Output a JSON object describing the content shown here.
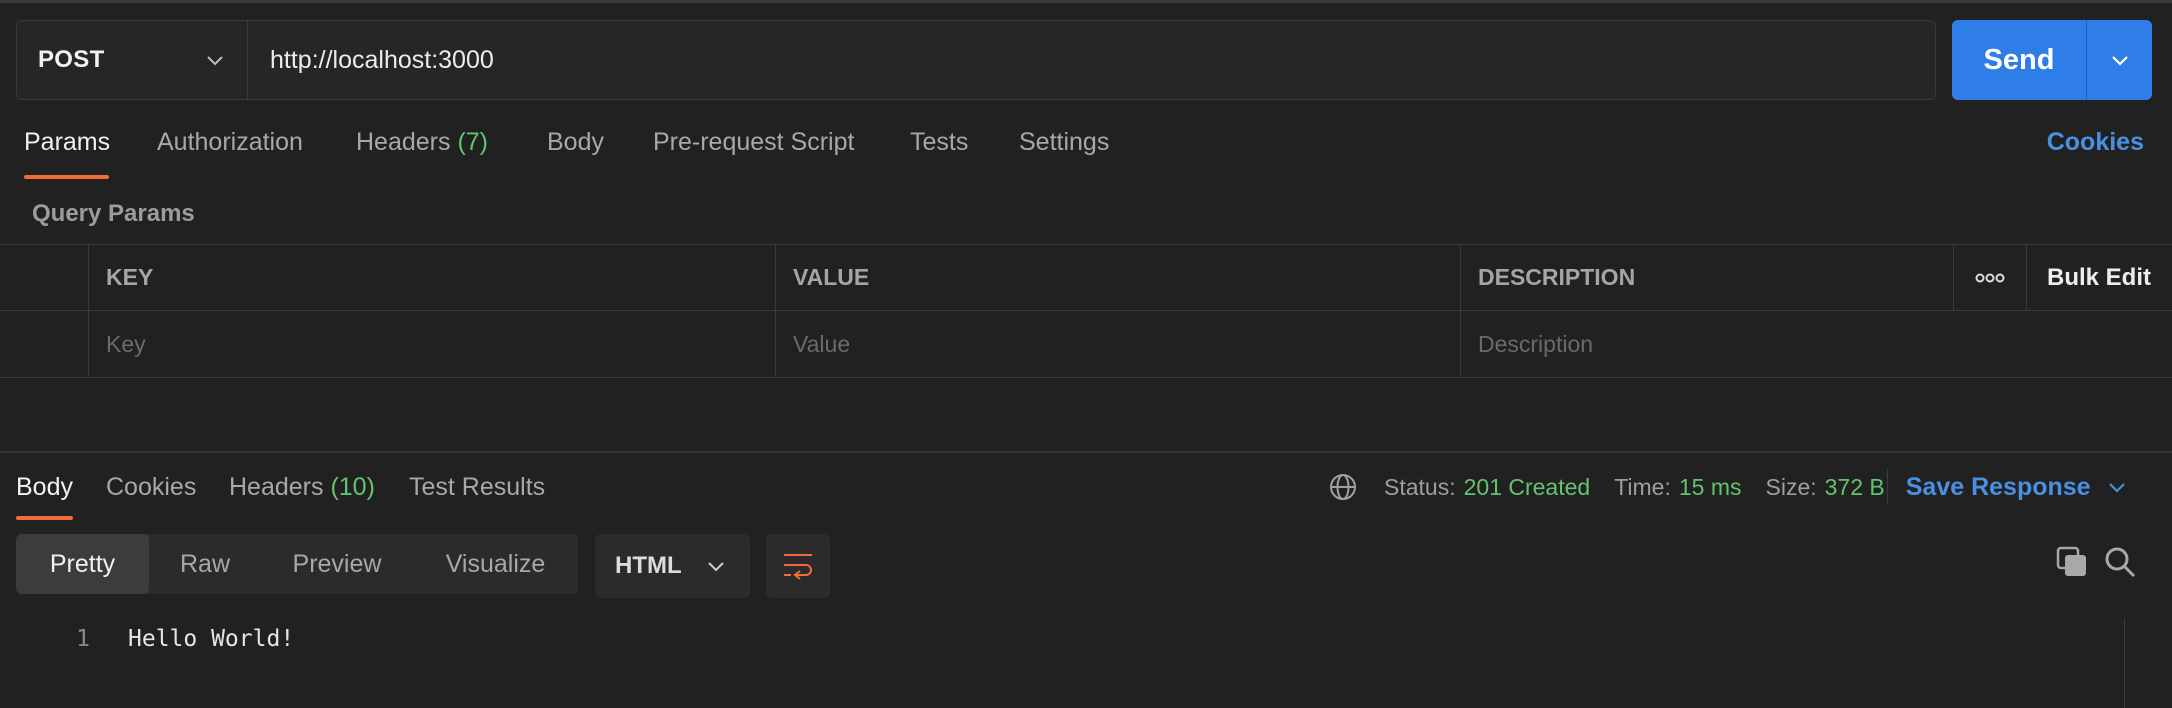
{
  "request": {
    "method": "POST",
    "url": "http://localhost:3000",
    "send_label": "Send"
  },
  "request_tabs": {
    "params": "Params",
    "authorization": "Authorization",
    "headers": "Headers",
    "headers_count": "(7)",
    "body": "Body",
    "prerequest": "Pre-request Script",
    "tests": "Tests",
    "settings": "Settings",
    "cookies": "Cookies",
    "active": "Params"
  },
  "query_params": {
    "title": "Query Params",
    "columns": [
      "KEY",
      "VALUE",
      "DESCRIPTION"
    ],
    "bulk_edit": "Bulk Edit",
    "placeholders": {
      "key": "Key",
      "value": "Value",
      "description": "Description"
    }
  },
  "response_tabs": {
    "body": "Body",
    "cookies": "Cookies",
    "headers": "Headers",
    "headers_count": "(10)",
    "test_results": "Test Results",
    "active": "Body"
  },
  "response_status": {
    "status_label": "Status:",
    "status_value": "201 Created",
    "time_label": "Time:",
    "time_value": "15 ms",
    "size_label": "Size:",
    "size_value": "372 B",
    "save_response": "Save Response"
  },
  "response_view": {
    "modes": [
      "Pretty",
      "Raw",
      "Preview",
      "Visualize"
    ],
    "active_mode": "Pretty",
    "language": "HTML"
  },
  "response_body": {
    "lines": [
      {
        "number": "1",
        "text": "Hello World!"
      }
    ]
  },
  "colors": {
    "accent_orange": "#f26b3a",
    "send_blue": "#2f7de6",
    "link_blue": "#4a90e2",
    "success_green": "#62c46e",
    "background": "#212121"
  },
  "icons": {
    "method_dropdown": "chevron-down-icon",
    "send_dropdown": "chevron-down-icon",
    "more": "more-horizontal-icon",
    "network": "globe-icon",
    "wrap": "wrap-lines-icon",
    "copy": "copy-icon",
    "search": "search-icon"
  }
}
